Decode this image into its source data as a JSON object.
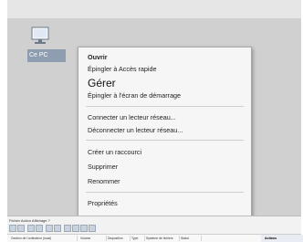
{
  "desktop": {
    "icon_label": "Ce PC"
  },
  "context_menu": {
    "items": [
      {
        "label": "Ouvrir"
      },
      {
        "label": "Épingler à Accès rapide"
      },
      {
        "label": "Gérer"
      },
      {
        "label": "Épingler à l'écran de démarrage"
      },
      {
        "label": "Connecter un lecteur réseau..."
      },
      {
        "label": "Déconnecter un lecteur réseau..."
      },
      {
        "label": "Créer un raccourci"
      },
      {
        "label": "Supprimer"
      },
      {
        "label": "Renommer"
      },
      {
        "label": "Propriétés"
      }
    ]
  },
  "mmc": {
    "menubar": "Fichier  Action  Affichage  ?",
    "columns": [
      "Gestion de l'ordinateur (local)",
      "Volume",
      "Disposition",
      "Type",
      "Système de fichiers",
      "Statut"
    ],
    "actions_label": "Actions"
  }
}
